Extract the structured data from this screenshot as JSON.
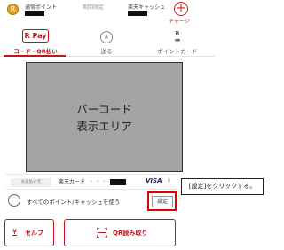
{
  "header": {
    "regular_points_label": "通常ポイント",
    "limited_points_label": "期間限定",
    "rakuten_cash_label": "楽天キャッシュ",
    "charge_label": "チャージ",
    "charge_symbol": "+",
    "coin_symbol": "R"
  },
  "tabs": [
    {
      "label": "コード・QR払い",
      "icon_text": "R Pay",
      "active": true
    },
    {
      "label": "送る",
      "icon_text": "¥",
      "active": false
    },
    {
      "label": "ポイントカード",
      "icon_text": "R",
      "active": false
    }
  ],
  "barcode_area": {
    "line1": "バーコード",
    "line2": "表示エリア"
  },
  "payment": {
    "source_label": "お支払い元",
    "card_name": "楽天カード",
    "dots": "・・・",
    "brand": "VISA",
    "chevron": "›"
  },
  "use_all": {
    "label": "すべてのポイント/キャッシュを使う",
    "settings_label": "設定"
  },
  "callout": {
    "text": "[設定]をクリックする。"
  },
  "buttons": {
    "self_icon": "¥",
    "self_label": "セルフ",
    "qr_label": "QR読み取り"
  },
  "colors": {
    "brand_red": "#c0141b",
    "highlight_red": "#e00000",
    "barcode_gray": "#a4a4a4"
  }
}
